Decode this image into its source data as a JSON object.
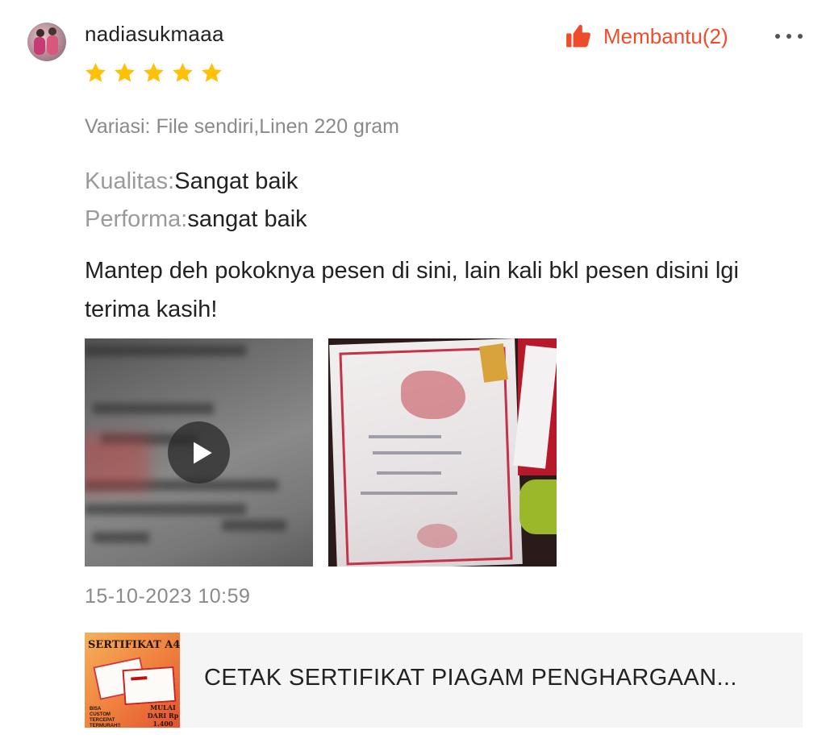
{
  "review": {
    "username": "nadiasukmaaa",
    "rating": 5,
    "rating_max": 5,
    "helpful_label": "Membantu(2)",
    "variation": "Variasi: File sendiri,Linen 220 gram",
    "attributes": [
      {
        "key": "Kualitas:",
        "value": "Sangat baik"
      },
      {
        "key": "Performa:",
        "value": "sangat baik"
      }
    ],
    "comment": "Mantep deh pokoknya pesen di sini, lain kali bkl pesen disini lgi terima kasih!",
    "timestamp": "15-10-2023 10:59"
  },
  "icons": {
    "avatar": "avatar",
    "star": "star-icon",
    "thumbs_up": "thumbs-up-icon",
    "more": "more-icon",
    "play": "play-icon"
  },
  "colors": {
    "accent": "#ee4d2d",
    "star": "#ffc107",
    "muted": "#8a8a8a"
  },
  "product": {
    "title": "CETAK SERTIFIKAT PIAGAM PENGHARGAAN...",
    "thumbnail": {
      "heading": "SERTIFIKAT A4",
      "note": "BISA CUSTOM TERCEPAT TERMURAH!!",
      "price": "MULAI DARI Rp 1.400"
    }
  }
}
